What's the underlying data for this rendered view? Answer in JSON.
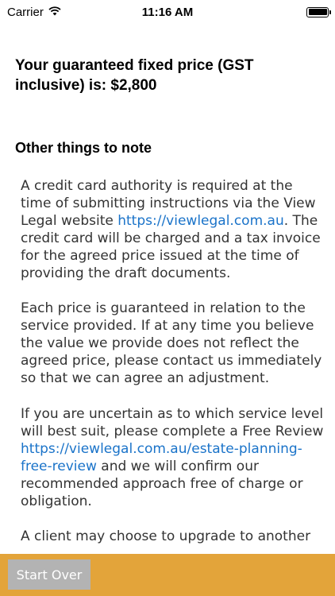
{
  "status_bar": {
    "carrier": "Carrier",
    "time": "11:16 AM"
  },
  "price": {
    "heading": "Your guaranteed fixed price (GST inclusive) is: $2,800"
  },
  "notes": {
    "heading": "Other things to note",
    "p1_a": "A credit card authority is required at the time of submitting instructions via the View Legal website ",
    "p1_link": "https://viewlegal.com.au",
    "p1_b": ".  The credit card will be charged and a tax invoice for the agreed price issued at the time of providing the draft documents.",
    "p2": "Each price is guaranteed in relation to the service provided.  If at any time you believe the value we provide does not reflect the agreed price, please contact us immediately so that we can agree an adjustment.",
    "p3_a": "If you are uncertain as to which service level will best suit, please complete a Free Review ",
    "p3_link": "https://viewlegal.com.au/estate-planning-free-review",
    "p3_b": " and we will confirm our recommended approach free of charge or obligation.",
    "p4": "A client may choose to upgrade to another"
  },
  "bottom": {
    "start_over_label": "Start Over"
  }
}
